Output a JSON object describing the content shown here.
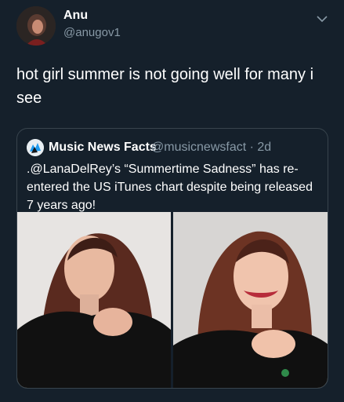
{
  "tweet": {
    "author_name": "Anu",
    "author_handle": "@anugov1",
    "text": "hot girl summer is not going well for many i see"
  },
  "quoted": {
    "author_name": "Music News Facts",
    "author_handle": "@musicnewsfact",
    "separator": "·",
    "age": "2d",
    "text": ".@LanaDelRey’s “Summertime Sadness” has re-entered the US iTunes chart despite being released 7 years ago!",
    "photos": [
      "lana-portrait-photo",
      "lana-smiling-photo"
    ]
  },
  "icons": [
    "avatar",
    "chevron-down-icon"
  ],
  "colors": {
    "background": "#15202b",
    "muted_text": "#8899a6",
    "border": "#38444d"
  }
}
